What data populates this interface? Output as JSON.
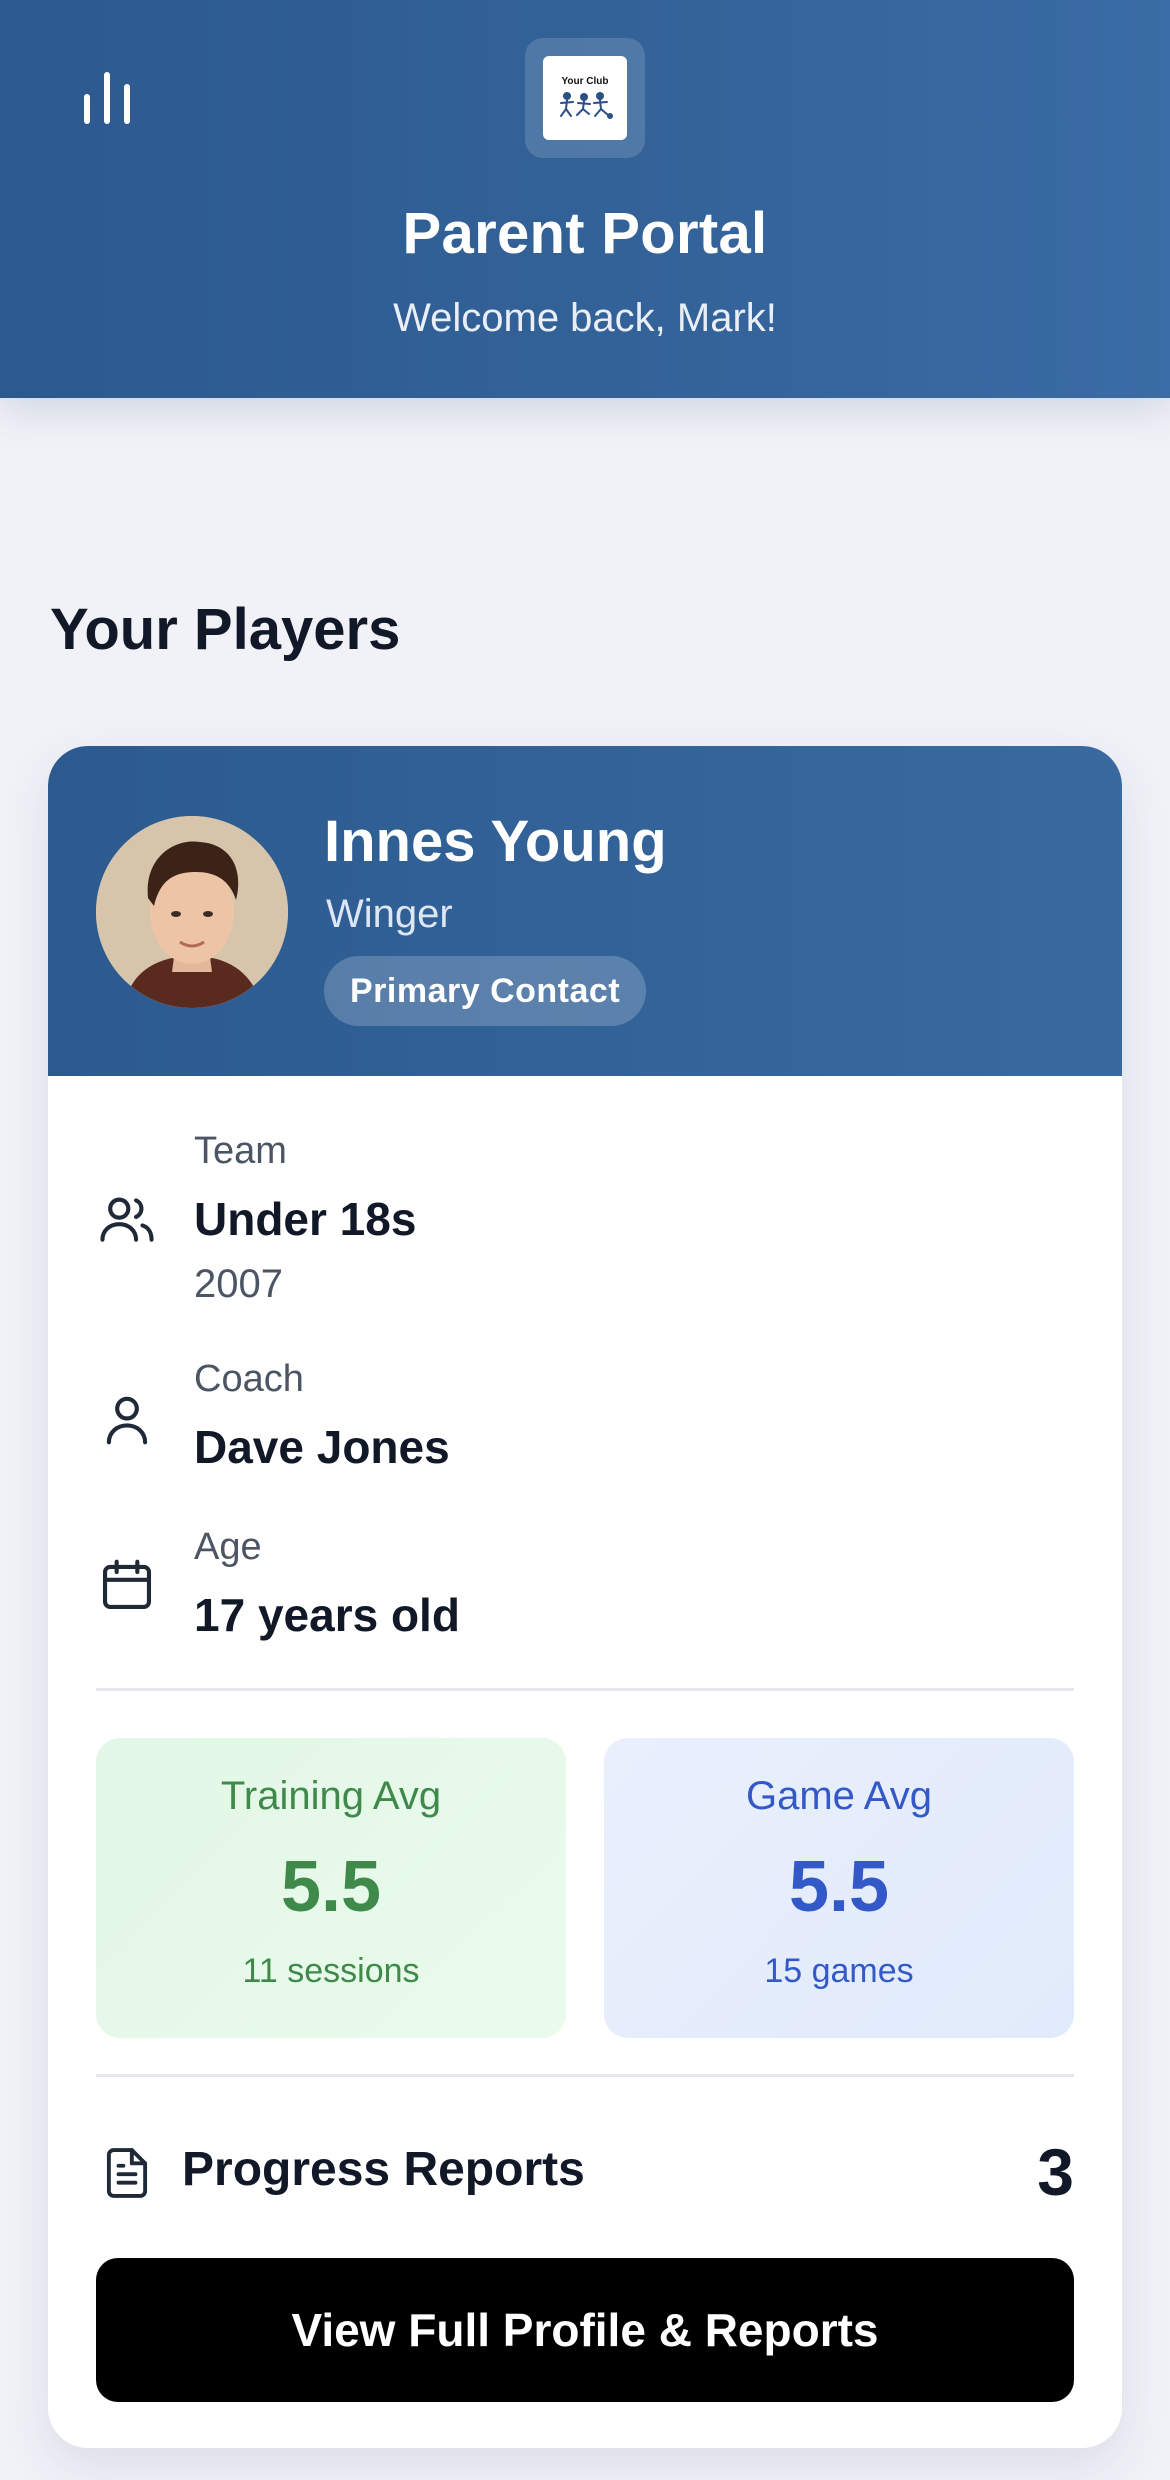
{
  "header": {
    "title": "Parent Portal",
    "welcome": "Welcome back, Mark!",
    "logo_text": "Your Club",
    "menu_icon": "bar-chart-icon"
  },
  "section": {
    "title": "Your Players"
  },
  "player": {
    "name": "Innes Young",
    "position": "Winger",
    "badge": "Primary Contact",
    "team_label": "Team",
    "team_value": "Under 18s",
    "team_year": "2007",
    "coach_label": "Coach",
    "coach_value": "Dave Jones",
    "age_label": "Age",
    "age_value": "17 years old",
    "training": {
      "label": "Training Avg",
      "value": "5.5",
      "sub": "11 sessions"
    },
    "game": {
      "label": "Game Avg",
      "value": "5.5",
      "sub": "15 games"
    },
    "reports_label": "Progress Reports",
    "reports_count": "3",
    "cta_label": "View Full Profile & Reports"
  },
  "colors": {
    "header_bg": "#2c5a8f",
    "training_text": "#3f8a4b",
    "game_text": "#3358c7",
    "cta_bg": "#000000"
  }
}
